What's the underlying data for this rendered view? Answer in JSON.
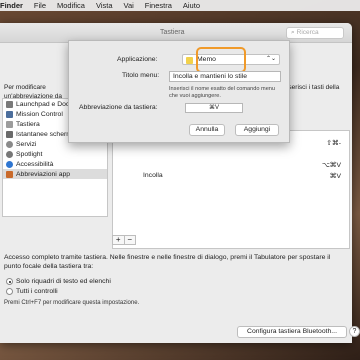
{
  "menubar": {
    "app": "Finder",
    "items": [
      "File",
      "Modifica",
      "Vista",
      "Vai",
      "Finestra",
      "Aiuto"
    ]
  },
  "window": {
    "title": "Tastiera",
    "search_placeholder": "Ricerca"
  },
  "left_description": "Per modificare un'abbreviazione da tastiera o aggiungere una nuova abbreviazione",
  "right_description": "Inserisci i tasti della",
  "sidebar": {
    "items": [
      {
        "label": "Launchpad e Dock",
        "icon": "launchpad-icon",
        "color": "#7a7a7a"
      },
      {
        "label": "Mission Control",
        "icon": "mission-control-icon",
        "color": "#4c6e9c"
      },
      {
        "label": "Tastiera",
        "icon": "keyboard-icon",
        "color": "#9c9c9c"
      },
      {
        "label": "Istantanee schermo",
        "icon": "screenshot-icon",
        "color": "#6a6a6a"
      },
      {
        "label": "Servizi",
        "icon": "gear-icon",
        "color": "#8a8a8a"
      },
      {
        "label": "Spotlight",
        "icon": "spotlight-icon",
        "color": "#777"
      },
      {
        "label": "Accessibilità",
        "icon": "accessibility-icon",
        "color": "#2f76d1"
      },
      {
        "label": "Abbreviazioni app",
        "icon": "app-shortcuts-icon",
        "color": "#c96a2b"
      }
    ],
    "selected_index": 7
  },
  "shortcuts": {
    "rows": [
      {
        "name": "",
        "key": "⇧⌘-"
      },
      {
        "name": "",
        "key": "⌥⌘V"
      },
      {
        "name": "Incolla",
        "key": "⌘V"
      }
    ]
  },
  "access": {
    "text": "Accesso completo tramite tastiera. Nelle finestre e nelle finestre di dialogo, premi il Tabulatore per spostare il punto focale della tastiera tra:",
    "option1": "Solo riquadri di testo ed elenchi",
    "option2": "Tutti i controlli",
    "hint": "Premi Ctrl+F7 per modificare questa impostazione."
  },
  "buttons": {
    "bluetooth": "Configura tastiera Bluetooth...",
    "help": "?"
  },
  "sheet": {
    "app_label": "Applicazione:",
    "app_value": "Memo",
    "menu_label": "Titolo menu:",
    "menu_value": "Incolla e mantieni lo stile",
    "note": "Inserisci il nome esatto del comando menu che vuoi aggiungere.",
    "shortcut_label": "Abbreviazione da tastiera:",
    "shortcut_value": "⌘V",
    "cancel": "Annulla",
    "add": "Aggiungi"
  },
  "colors": {
    "highlight": "#f09a2a",
    "selected_row": "#dcdcdc"
  }
}
